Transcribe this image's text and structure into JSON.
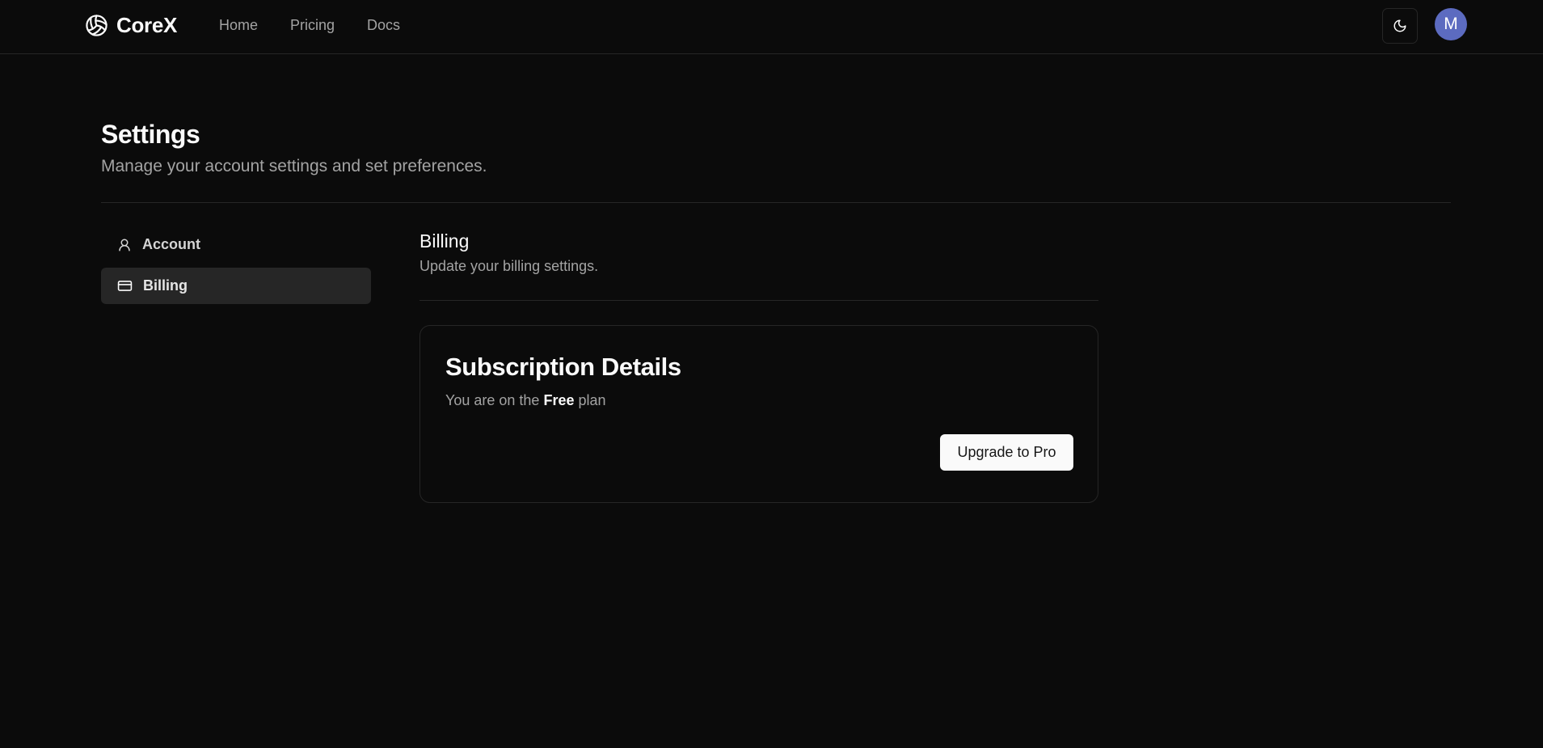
{
  "header": {
    "brand": "CoreX",
    "nav": [
      {
        "label": "Home"
      },
      {
        "label": "Pricing"
      },
      {
        "label": "Docs"
      }
    ],
    "theme_icon": "moon-icon",
    "avatar_initial": "M"
  },
  "page": {
    "title": "Settings",
    "subtitle": "Manage your account settings and set preferences."
  },
  "sidebar": {
    "items": [
      {
        "label": "Account",
        "icon": "user-icon",
        "active": false
      },
      {
        "label": "Billing",
        "icon": "credit-card-icon",
        "active": true
      }
    ]
  },
  "section": {
    "title": "Billing",
    "subtitle": "Update your billing settings."
  },
  "subscription": {
    "title": "Subscription Details",
    "text_prefix": "You are on the",
    "plan": "Free",
    "text_suffix": "plan",
    "upgrade_label": "Upgrade to Pro"
  },
  "colors": {
    "background": "#0b0b0b",
    "border": "#262626",
    "muted_text": "#a3a3a3",
    "active_item_bg": "#262626",
    "avatar_bg": "#5c6bc0",
    "button_bg": "#fafafa"
  }
}
